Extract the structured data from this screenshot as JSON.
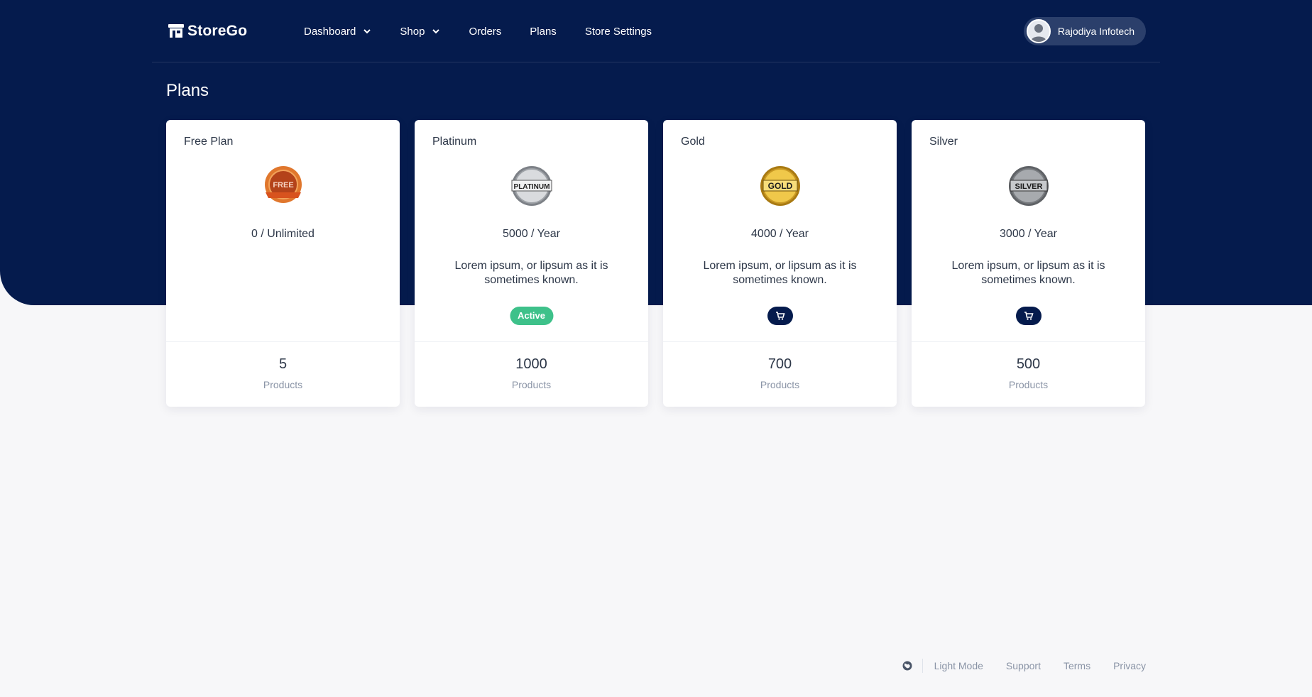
{
  "app": {
    "name": "StoreGo"
  },
  "nav": {
    "items": [
      {
        "label": "Dashboard",
        "dropdown": true
      },
      {
        "label": "Shop",
        "dropdown": true
      },
      {
        "label": "Orders",
        "dropdown": false
      },
      {
        "label": "Plans",
        "dropdown": false
      },
      {
        "label": "Store Settings",
        "dropdown": false
      }
    ]
  },
  "user": {
    "name": "Rajodiya Infotech"
  },
  "page": {
    "title": "Plans"
  },
  "plans": [
    {
      "name": "Free Plan",
      "badge_text": "FREE",
      "price": "0 / Unlimited",
      "description": "",
      "status": "",
      "products": "5",
      "products_label": "Products",
      "badge_color": "#c8501f"
    },
    {
      "name": "Platinum",
      "badge_text": "PLATINUM",
      "price": "5000 / Year",
      "description": "Lorem ipsum, or lipsum as it is sometimes known.",
      "status": "Active",
      "products": "1000",
      "products_label": "Products",
      "badge_color": "#b8bcc2"
    },
    {
      "name": "Gold",
      "badge_text": "GOLD",
      "price": "4000 / Year",
      "description": "Lorem ipsum, or lipsum as it is sometimes known.",
      "status": "",
      "products": "700",
      "products_label": "Products",
      "badge_color": "#d4a527"
    },
    {
      "name": "Silver",
      "badge_text": "SILVER",
      "price": "3000 / Year",
      "description": "Lorem ipsum, or lipsum as it is sometimes known.",
      "status": "",
      "products": "500",
      "products_label": "Products",
      "badge_color": "#8e9196"
    }
  ],
  "footer": {
    "icon": "globe-icon",
    "links": [
      "Light Mode",
      "Support",
      "Terms",
      "Privacy"
    ]
  },
  "colors": {
    "primary": "#051b4d",
    "active": "#3ec18a",
    "background": "#f7f7f9"
  }
}
